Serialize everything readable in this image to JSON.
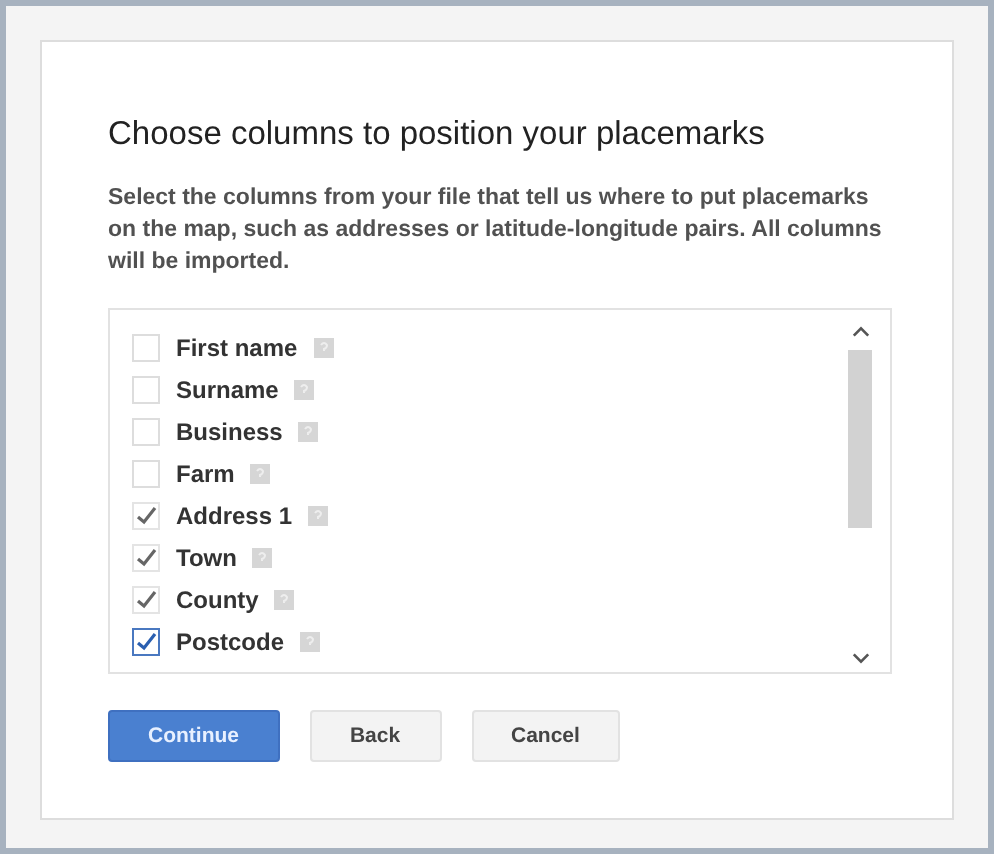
{
  "dialog": {
    "title": "Choose columns to position your placemarks",
    "description": "Select the columns from your file that tell us where to put placemarks on the map, such as addresses or latitude-longitude pairs. All columns will be imported."
  },
  "columns": [
    {
      "label": "First name",
      "checked": false,
      "focused": false
    },
    {
      "label": "Surname",
      "checked": false,
      "focused": false
    },
    {
      "label": "Business",
      "checked": false,
      "focused": false
    },
    {
      "label": "Farm",
      "checked": false,
      "focused": false
    },
    {
      "label": "Address 1",
      "checked": true,
      "focused": false
    },
    {
      "label": "Town",
      "checked": true,
      "focused": false
    },
    {
      "label": "County",
      "checked": true,
      "focused": false
    },
    {
      "label": "Postcode",
      "checked": true,
      "focused": true
    }
  ],
  "buttons": [
    {
      "label": "Continue",
      "kind": "primary"
    },
    {
      "label": "Back",
      "kind": "secondary"
    },
    {
      "label": "Cancel",
      "kind": "secondary"
    }
  ]
}
